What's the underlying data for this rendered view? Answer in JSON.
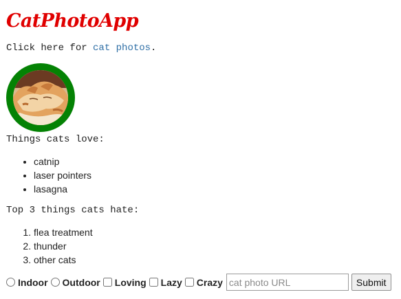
{
  "header": {
    "title": "CatPhotoApp"
  },
  "intro": {
    "prefix": "Click here for ",
    "link_text": "cat photos",
    "suffix": "."
  },
  "photo": {
    "subject": "sleeping orange tabby cat",
    "border_color": "#048204"
  },
  "loves": {
    "heading": "Things cats love:",
    "items": [
      "catnip",
      "laser pointers",
      "lasagna"
    ]
  },
  "hates": {
    "heading": "Top 3 things cats hate:",
    "items": [
      "flea treatment",
      "thunder",
      "other cats"
    ]
  },
  "form": {
    "radios": [
      {
        "label": "Indoor",
        "checked": false
      },
      {
        "label": "Outdoor",
        "checked": false
      }
    ],
    "checkboxes": [
      {
        "label": "Loving",
        "checked": false
      },
      {
        "label": "Lazy",
        "checked": false
      },
      {
        "label": "Crazy",
        "checked": false
      }
    ],
    "url_placeholder": "cat photo URL",
    "url_value": "",
    "submit_label": "Submit"
  },
  "colors": {
    "title": "#e00000",
    "link": "#2f6fa6",
    "photo_border": "#048204"
  }
}
